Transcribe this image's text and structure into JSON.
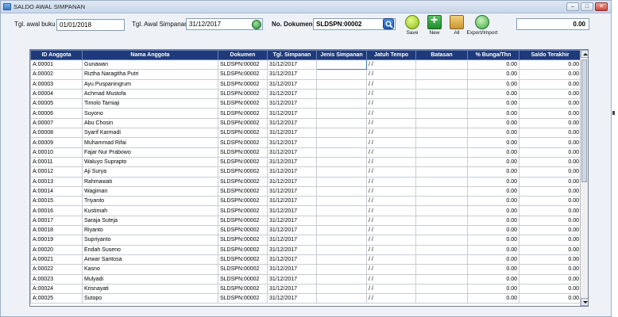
{
  "window": {
    "title": "SALDO AWAL SIMPANAN",
    "controls": {
      "minimize": "–",
      "maximize": "□",
      "close": "✕"
    }
  },
  "filters": {
    "tgl_awal_buku_label": "Tgl. awal buku",
    "tgl_awal_buku_value": "01/01/2018",
    "tgl_awal_simpanan_label": "Tgl. Awal Simpanan",
    "tgl_awal_simpanan_value": "31/12/2017",
    "no_dokumen_label": "No. Dokumen",
    "no_dokumen_value": "SLDSPN:00002",
    "total_value": "0.00"
  },
  "toolbar": {
    "save_label": "Save",
    "new_label": "New",
    "all_label": "All",
    "export_label": "Export/Import",
    "icons": [
      "save-icon",
      "new-icon",
      "all-icon",
      "export-import-icon"
    ]
  },
  "table": {
    "columns": [
      "ID Anggota",
      "Nama Anggota",
      "Dokumen",
      "Tgl. Simpanan",
      "Jenis Simpanan",
      "Jatuh Tempo",
      "Batasan",
      "% Bunga/Thn",
      "Saldo Terakhir"
    ],
    "rows": [
      [
        "A:00001",
        "Gunawan",
        "SLDSPN:00002",
        "31/12/2017",
        "",
        "/ /",
        "",
        "0.00",
        "0.00"
      ],
      [
        "A:00002",
        "Riztha Naragitha Putri",
        "SLDSPN:00002",
        "31/12/2017",
        "",
        "/ /",
        "",
        "0.00",
        "0.00"
      ],
      [
        "A:00003",
        "Ayu Puspaningrum",
        "SLDSPN:00002",
        "31/12/2017",
        "",
        "/ /",
        "",
        "0.00",
        "0.00"
      ],
      [
        "A:00004",
        "Achmad Mustofa",
        "SLDSPN:00002",
        "31/12/2017",
        "",
        "/ /",
        "",
        "0.00",
        "0.00"
      ],
      [
        "A:00005",
        "Timolo Tamiaji",
        "SLDSPN:00002",
        "31/12/2017",
        "",
        "/ /",
        "",
        "0.00",
        "0.00"
      ],
      [
        "A:00006",
        "Suyono",
        "SLDSPN:00002",
        "31/12/2017",
        "",
        "/ /",
        "",
        "0.00",
        "0.00"
      ],
      [
        "A:00007",
        "Abu Chosin",
        "SLDSPN:00002",
        "31/12/2017",
        "",
        "/ /",
        "",
        "0.00",
        "0.00"
      ],
      [
        "A:00008",
        "Syarif Karmadi",
        "SLDSPN:00002",
        "31/12/2017",
        "",
        "/ /",
        "",
        "0.00",
        "0.00"
      ],
      [
        "A:00009",
        "Muhammad Rifai",
        "SLDSPN:00002",
        "31/12/2017",
        "",
        "/ /",
        "",
        "0.00",
        "0.00"
      ],
      [
        "A:00010",
        "Fajar Nur Prabowo",
        "SLDSPN:00002",
        "31/12/2017",
        "",
        "/ /",
        "",
        "0.00",
        "0.00"
      ],
      [
        "A:00011",
        "Waluyo Suprapto",
        "SLDSPN:00002",
        "31/12/2017",
        "",
        "/ /",
        "",
        "0.00",
        "0.00"
      ],
      [
        "A:00012",
        "Aji Surya",
        "SLDSPN:00002",
        "31/12/2017",
        "",
        "/ /",
        "",
        "0.00",
        "0.00"
      ],
      [
        "A:00013",
        "Rahmawati",
        "SLDSPN:00002",
        "31/12/2017",
        "",
        "/ /",
        "",
        "0.00",
        "0.00"
      ],
      [
        "A:00014",
        "Wagiman",
        "SLDSPN:00002",
        "31/12/2017",
        "",
        "/ /",
        "",
        "0.00",
        "0.00"
      ],
      [
        "A:00015",
        "Triyanto",
        "SLDSPN:00002",
        "31/12/2017",
        "",
        "/ /",
        "",
        "0.00",
        "0.00"
      ],
      [
        "A:00016",
        "Kustimah",
        "SLDSPN:00002",
        "31/12/2017",
        "",
        "/ /",
        "",
        "0.00",
        "0.00"
      ],
      [
        "A:00017",
        "Saraja Suteja",
        "SLDSPN:00002",
        "31/12/2017",
        "",
        "/ /",
        "",
        "0.00",
        "0.00"
      ],
      [
        "A:00018",
        "Riyanto",
        "SLDSPN:00002",
        "31/12/2017",
        "",
        "/ /",
        "",
        "0.00",
        "0.00"
      ],
      [
        "A:00019",
        "Supriyanto",
        "SLDSPN:00002",
        "31/12/2017",
        "",
        "/ /",
        "",
        "0.00",
        "0.00"
      ],
      [
        "A:00020",
        "Endah Suseno",
        "SLDSPN:00002",
        "31/12/2017",
        "",
        "/ /",
        "",
        "0.00",
        "0.00"
      ],
      [
        "A:00021",
        "Anwar Santosa",
        "SLDSPN:00002",
        "31/12/2017",
        "",
        "/ /",
        "",
        "0.00",
        "0.00"
      ],
      [
        "A:00022",
        "Kasno",
        "SLDSPN:00002",
        "31/12/2017",
        "",
        "/ /",
        "",
        "0.00",
        "0.00"
      ],
      [
        "A:00023",
        "Mulyadi",
        "SLDSPN:00002",
        "31/12/2017",
        "",
        "/ /",
        "",
        "0.00",
        "0.00"
      ],
      [
        "A:00024",
        "Krisnayati",
        "SLDSPN:00002",
        "31/12/2017",
        "",
        "/ /",
        "",
        "0.00",
        "0.00"
      ],
      [
        "A:00025",
        "Sutopo",
        "SLDSPN:00002",
        "31/12/2017",
        "",
        "/ /",
        "",
        "0.00",
        "0.00"
      ]
    ]
  }
}
